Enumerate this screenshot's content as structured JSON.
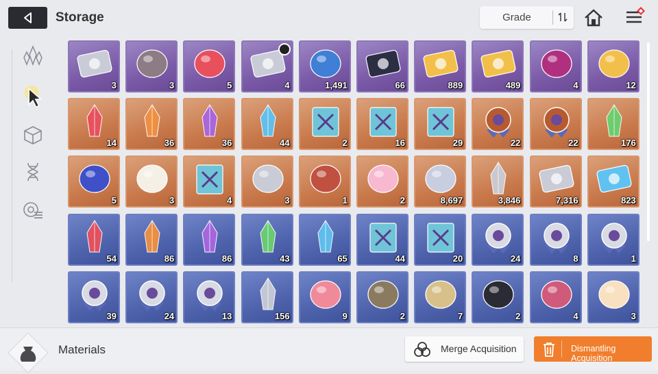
{
  "header": {
    "title": "Storage",
    "sort_label": "Grade"
  },
  "sidebar": {
    "tabs": [
      "gems-icon",
      "materials-icon",
      "cube-icon",
      "dna-icon",
      "gear-list-icon"
    ],
    "active": 1
  },
  "inventory": {
    "rows": [
      {
        "bg": "purple",
        "items": [
          {
            "icon": "card-ticket",
            "count": "3"
          },
          {
            "icon": "rock-face",
            "count": "3"
          },
          {
            "icon": "red-ore",
            "count": "5"
          },
          {
            "icon": "triangle-chip",
            "count": "4",
            "timer": true
          },
          {
            "icon": "blue-creature",
            "count": "1,491"
          },
          {
            "icon": "dark-chip",
            "count": "66"
          },
          {
            "icon": "gold-ticket",
            "count": "889"
          },
          {
            "icon": "gold-ticket-b",
            "count": "489"
          },
          {
            "icon": "purple-eye",
            "count": "4"
          },
          {
            "icon": "gold-feather",
            "count": "12"
          }
        ]
      },
      {
        "bg": "orange",
        "items": [
          {
            "icon": "red-crystal",
            "count": "14"
          },
          {
            "icon": "orange-crystal",
            "count": "36"
          },
          {
            "icon": "purple-crystal",
            "count": "36"
          },
          {
            "icon": "blue-crystal",
            "count": "44"
          },
          {
            "icon": "book-x",
            "count": "2"
          },
          {
            "icon": "book-v",
            "count": "16"
          },
          {
            "icon": "book-o",
            "count": "29"
          },
          {
            "icon": "medal-gear",
            "count": "22"
          },
          {
            "icon": "medal-gear-b",
            "count": "22"
          },
          {
            "icon": "green-shard",
            "count": "176"
          }
        ]
      },
      {
        "bg": "orange",
        "items": [
          {
            "icon": "blue-cube",
            "count": "5"
          },
          {
            "icon": "sneakers",
            "count": "3"
          },
          {
            "icon": "star-book",
            "count": "4"
          },
          {
            "icon": "silver-gun",
            "count": "3"
          },
          {
            "icon": "dreamcatcher",
            "count": "1"
          },
          {
            "icon": "guitar-pick",
            "count": "2"
          },
          {
            "icon": "treble-clef",
            "count": "8,697"
          },
          {
            "icon": "black-shard",
            "count": "3,846"
          },
          {
            "icon": "silver-ticket",
            "count": "7,316"
          },
          {
            "icon": "blue-ticket",
            "count": "823"
          }
        ]
      },
      {
        "bg": "blue",
        "items": [
          {
            "icon": "red-shard",
            "count": "54"
          },
          {
            "icon": "orange-shard",
            "count": "86"
          },
          {
            "icon": "purple-shard",
            "count": "86"
          },
          {
            "icon": "green-shard",
            "count": "43"
          },
          {
            "icon": "blue-shard",
            "count": "65"
          },
          {
            "icon": "book-x",
            "count": "44"
          },
          {
            "icon": "book-o",
            "count": "20"
          },
          {
            "icon": "silver-medal",
            "count": "24"
          },
          {
            "icon": "silver-medal-b",
            "count": "8"
          },
          {
            "icon": "silver-medal-c",
            "count": "1"
          }
        ]
      },
      {
        "bg": "blue",
        "items": [
          {
            "icon": "silver-badge",
            "count": "39"
          },
          {
            "icon": "silver-badge-b",
            "count": "24"
          },
          {
            "icon": "silver-badge-c",
            "count": "13"
          },
          {
            "icon": "ice-crystal",
            "count": "156"
          },
          {
            "icon": "cake",
            "count": "9"
          },
          {
            "icon": "pocket-watch",
            "count": "2"
          },
          {
            "icon": "gold-pouch",
            "count": "7"
          },
          {
            "icon": "dark-mask",
            "count": "2"
          },
          {
            "icon": "flower-bouquet",
            "count": "4"
          },
          {
            "icon": "sparkler",
            "count": "3"
          }
        ]
      }
    ]
  },
  "footer": {
    "section_label": "Materials",
    "merge_label": "Merge Acquisition",
    "dismantle_label": "Dismantling Acquisition"
  },
  "colors": {
    "orange_button": "#f07e2c",
    "purple_tile": "#7b5aa8",
    "orange_tile": "#c97a4c",
    "blue_tile": "#4f63ad"
  }
}
